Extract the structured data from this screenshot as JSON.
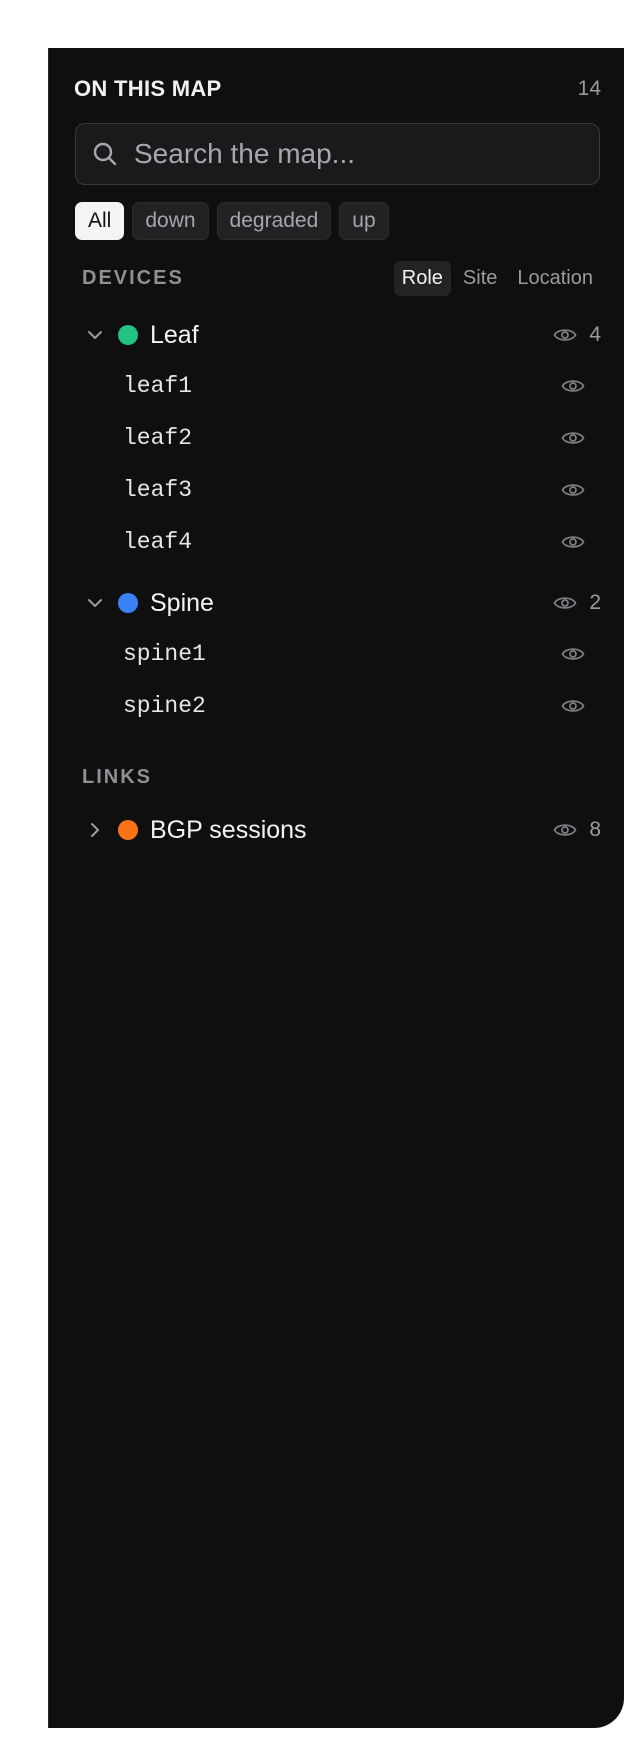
{
  "header": {
    "title": "ON THIS MAP",
    "count": "14"
  },
  "search": {
    "placeholder": "Search the map..."
  },
  "filters": [
    {
      "label": "All",
      "active": true
    },
    {
      "label": "down",
      "active": false
    },
    {
      "label": "degraded",
      "active": false
    },
    {
      "label": "up",
      "active": false
    }
  ],
  "devices": {
    "label": "DEVICES",
    "group_by": [
      {
        "label": "Role",
        "active": true
      },
      {
        "label": "Site",
        "active": false
      },
      {
        "label": "Location",
        "active": false
      }
    ],
    "groups": [
      {
        "name": "Leaf",
        "count": "4",
        "color": "#22c184",
        "expanded": true,
        "items": [
          "leaf1",
          "leaf2",
          "leaf3",
          "leaf4"
        ]
      },
      {
        "name": "Spine",
        "count": "2",
        "color": "#3b82f6",
        "expanded": true,
        "items": [
          "spine1",
          "spine2"
        ]
      }
    ]
  },
  "links": {
    "label": "LINKS",
    "groups": [
      {
        "name": "BGP sessions",
        "count": "8",
        "color": "#f97316",
        "expanded": false
      }
    ]
  },
  "icons": {
    "search": "search-icon",
    "eye": "eye-icon",
    "chevron_down": "chevron-down-icon",
    "chevron_right": "chevron-right-icon"
  }
}
